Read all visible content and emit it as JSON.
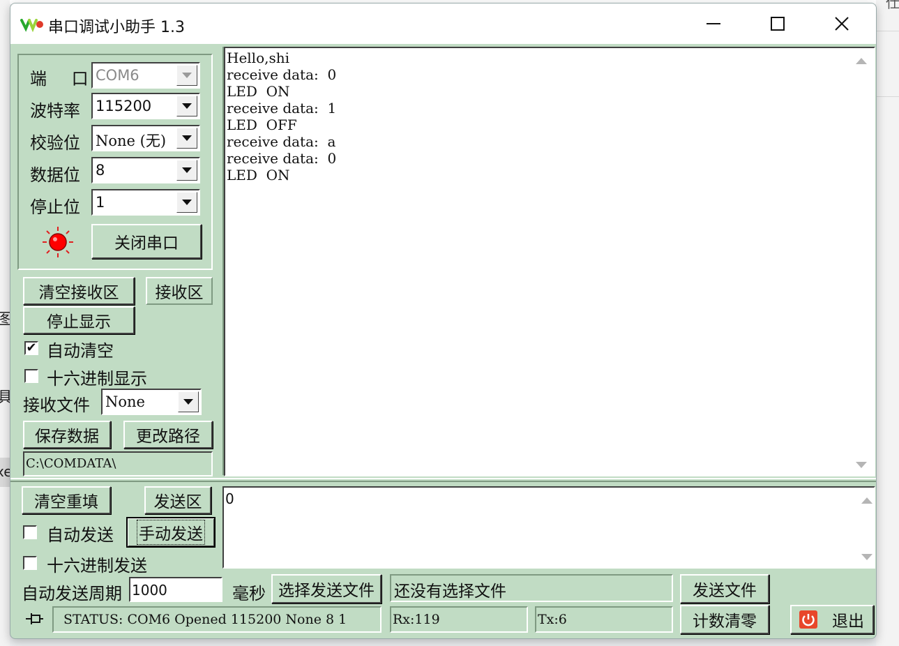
{
  "window": {
    "title": "串口调试小助手 1.3"
  },
  "port_settings": {
    "port_label": "端 口",
    "port_value": "COM6",
    "baud_label": "波特率",
    "baud_value": "115200",
    "parity_label": "校验位",
    "parity_value": "None (无)",
    "databits_label": "数据位",
    "databits_value": "8",
    "stopbits_label": "停止位",
    "stopbits_value": "1",
    "close_port_label": "关闭串口",
    "indicator_color": "#ff0000"
  },
  "receive_controls": {
    "clear_receive_label": "清空接收区",
    "receive_area_label": "接收区",
    "stop_display_label": "停止显示",
    "auto_clear_label": "自动清空",
    "auto_clear_checked": "✔",
    "hex_display_label": "十六进制显示",
    "receive_file_label": "接收文件",
    "receive_file_value": "None",
    "save_data_label": "保存数据",
    "change_path_label": "更改路径",
    "path_value": "C:\\COMDATA\\"
  },
  "receive_area": {
    "lines": [
      "Hello,shi",
      "receive data:  0",
      "LED  ON",
      "receive data:  1",
      "LED  OFF",
      "receive data:  a",
      "receive data:  0",
      "LED  ON"
    ]
  },
  "send_controls": {
    "clear_refill_label": "清空重填",
    "send_area_label": "发送区",
    "auto_send_label": "自动发送",
    "manual_send_label": "手动发送",
    "hex_send_label": "十六进制发送",
    "auto_send_period_label": "自动发送周期",
    "period_value": "1000",
    "ms_label": "毫秒",
    "select_file_label": "选择发送文件",
    "file_status": "还没有选择文件",
    "send_file_label": "发送文件",
    "send_text": "0"
  },
  "status_bar": {
    "status_text": "STATUS: COM6 Opened 115200 None  8 1",
    "rx_text": "Rx:119",
    "tx_text": "Tx:6",
    "reset_count_label": "计数清零",
    "exit_label": "退出"
  },
  "background": {
    "left_frag_1": "图",
    "left_frag_2": "具",
    "left_frag_3": "xe",
    "right_frag": "仕"
  }
}
